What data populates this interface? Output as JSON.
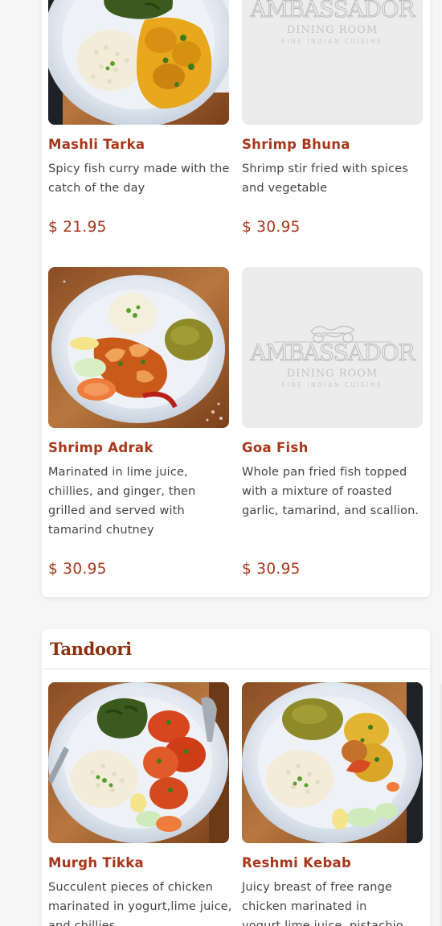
{
  "colors": {
    "accent": "#a8361a",
    "section_title": "#8b2f0f",
    "description": "#444444",
    "page_background": "#f6f6f6",
    "placeholder_background": "#ececec",
    "placeholder_logo": "#b9b9b9"
  },
  "placeholder_logo": {
    "brand": "AMBASSADOR",
    "line2": "DINING ROOM",
    "line3": "FINE INDIAN CUISINE"
  },
  "sections": [
    {
      "items": [
        {
          "name": "Mashli Tarka",
          "description": "Spicy fish curry made with the catch of the day",
          "price": "$ 21.95",
          "image": "fish-curry-plate-photo"
        },
        {
          "name": "Shrimp Bhuna",
          "description": "Shrimp stir fried with spices and vegetable",
          "price": "$ 30.95",
          "image": "restaurant-logo-placeholder"
        },
        {
          "name": "Shrimp Adrak",
          "description": "Marinated in lime juice, chillies, and ginger, then grilled and served with tamarind chutney",
          "price": "$ 30.95",
          "image": "grilled-shrimp-plate-photo"
        },
        {
          "name": "Goa Fish",
          "description": "Whole pan fried fish topped with a mixture of roasted garlic, tamarind, and scallion.",
          "price": "$ 30.95",
          "image": "restaurant-logo-placeholder"
        }
      ]
    },
    {
      "title": "Tandoori",
      "items": [
        {
          "name": "Murgh Tikka",
          "description": "Succulent pieces of chicken marinated in yogurt,lime juice, and chillies",
          "image": "chicken-tikka-plate-photo"
        },
        {
          "name": "Reshmi Kebab",
          "description": "Juicy breast of free range chicken marinated in yogurt,lime juice, pistachio",
          "image": "reshmi-kebab-plate-photo"
        }
      ]
    }
  ]
}
